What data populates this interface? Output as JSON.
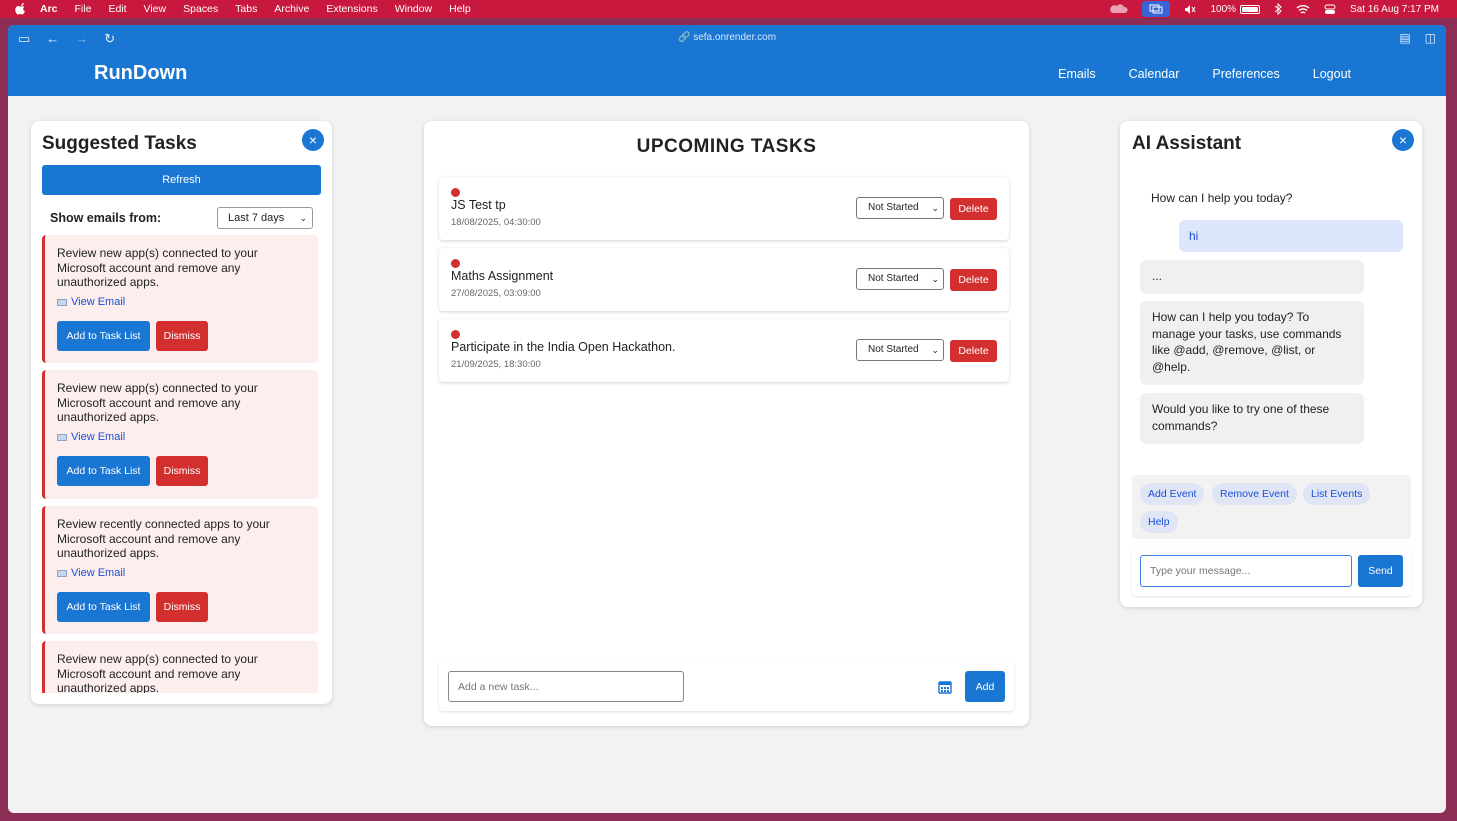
{
  "menubar": {
    "app": "Arc",
    "items": [
      "File",
      "Edit",
      "View",
      "Spaces",
      "Tabs",
      "Archive",
      "Extensions",
      "Window",
      "Help"
    ],
    "battery": "100%",
    "datetime": "Sat 16 Aug  7:17 PM"
  },
  "browser": {
    "url": "sefa.onrender.com"
  },
  "header": {
    "brand": "RunDown",
    "nav": [
      "Emails",
      "Calendar",
      "Preferences",
      "Logout"
    ]
  },
  "suggested": {
    "title": "Suggested Tasks",
    "close": "×",
    "refresh_label": "Refresh",
    "show_from_label": "Show emails from:",
    "range_value": "Last 7 days",
    "view_email_label": "View Email",
    "add_label": "Add to Task List",
    "dismiss_label": "Dismiss",
    "emails": [
      {
        "text": "Review new app(s) connected to your Microsoft account and remove any unauthorized apps."
      },
      {
        "text": "Review new app(s) connected to your Microsoft account and remove any unauthorized apps."
      },
      {
        "text": "Review recently connected apps to your Microsoft account and remove any unauthorized apps."
      },
      {
        "text": "Review new app(s) connected to your Microsoft account and remove any unauthorized apps."
      }
    ]
  },
  "upcoming": {
    "title": "UPCOMING TASKS",
    "status_value": "Not Started",
    "delete_label": "Delete",
    "tasks": [
      {
        "title": "JS Test tp",
        "date": "18/08/2025, 04:30:00"
      },
      {
        "title": "Maths Assignment",
        "date": "27/08/2025, 03:09:00"
      },
      {
        "title": "Participate in the India Open Hackathon.",
        "date": "21/09/2025, 18:30:00"
      }
    ],
    "new_task_placeholder": "Add a new task...",
    "add_label": "Add"
  },
  "assistant": {
    "title": "AI Assistant",
    "close": "×",
    "greeting": "How can I help you today?",
    "user_msg": "hi",
    "bot_msgs": [
      "...",
      "How can I help you today? To manage your tasks, use commands like @add, @remove, @list, or @help.",
      "Would you like to try one of these commands?"
    ],
    "chips": [
      "Add Event",
      "Remove Event",
      "List Events",
      "Help"
    ],
    "input_placeholder": "Type your message...",
    "send_label": "Send"
  },
  "colors": {
    "primary": "#1976d2",
    "danger": "#d32f2f",
    "menubar": "#c8183d"
  }
}
